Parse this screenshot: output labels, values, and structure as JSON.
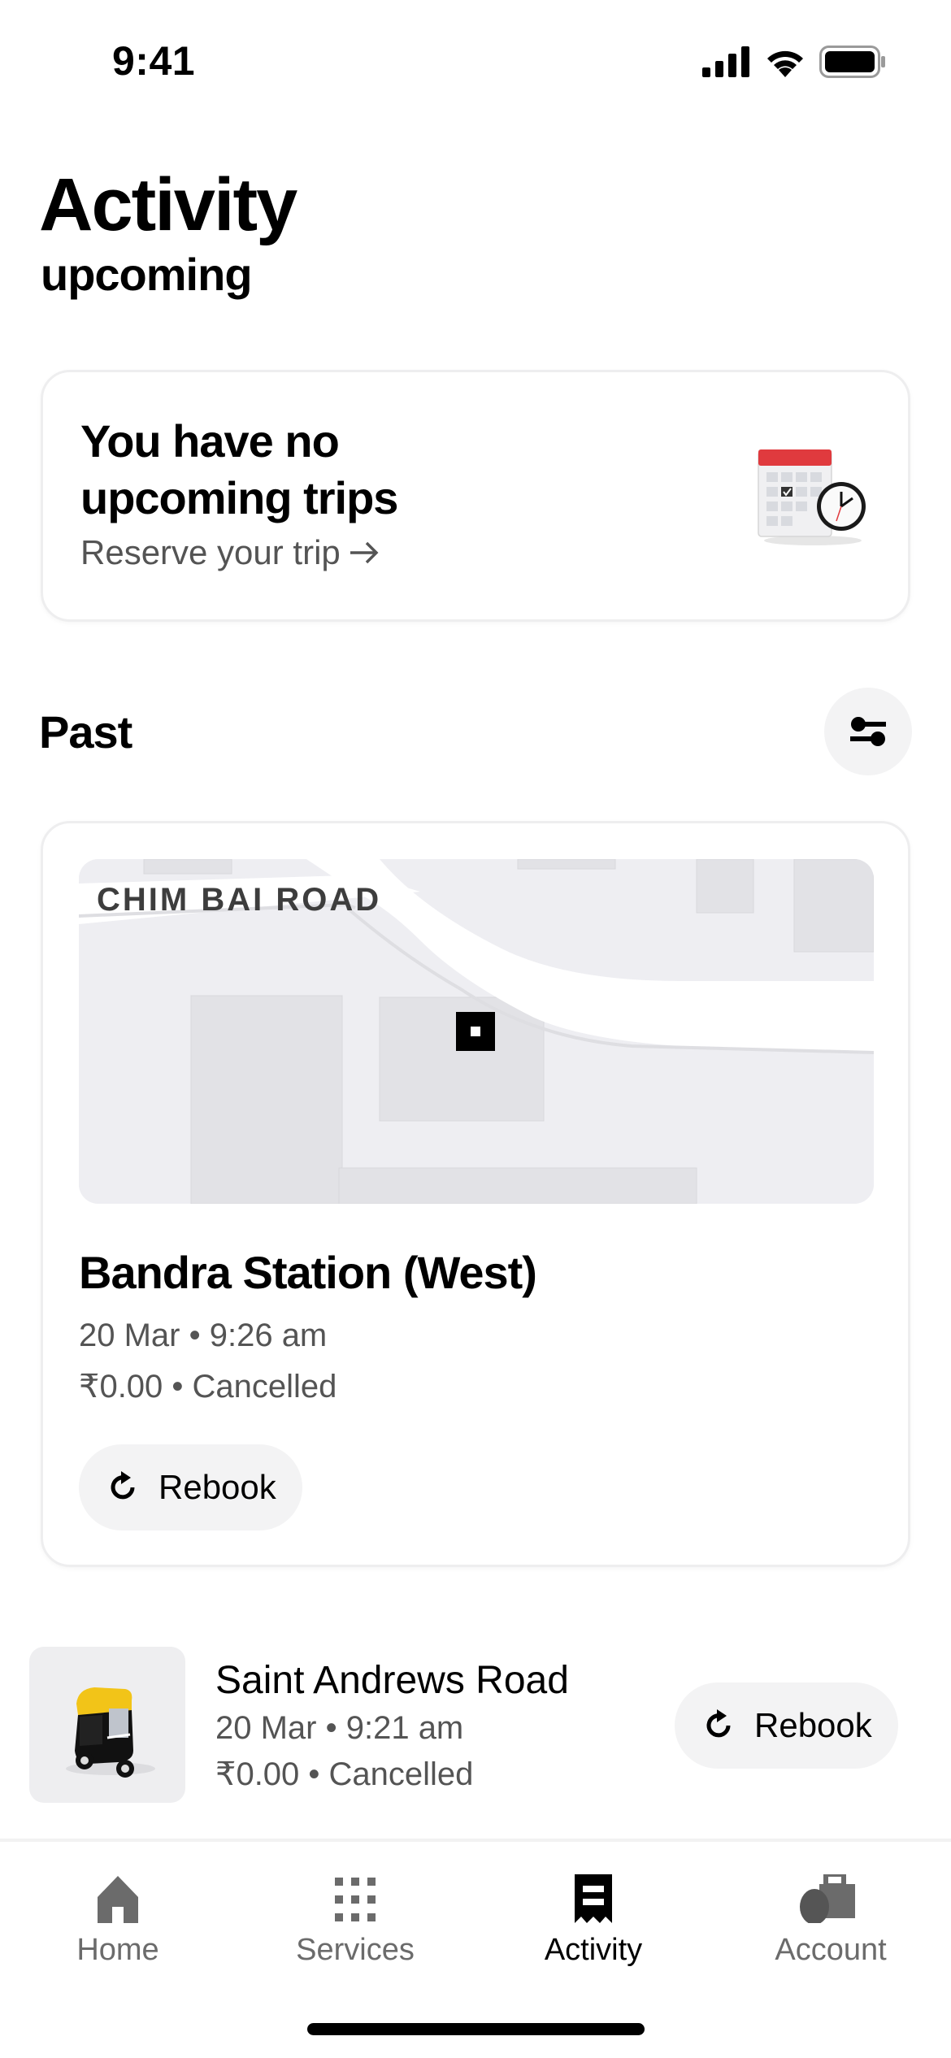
{
  "status_bar": {
    "time": "9:41",
    "icons": [
      "cellular-signal-icon",
      "wifi-icon",
      "battery-icon"
    ]
  },
  "header": {
    "title": "Activity",
    "subtitle": "upcoming"
  },
  "upcoming": {
    "title": "You have no upcoming trips",
    "link_label": "Reserve your trip",
    "link_icon": "arrow-right-icon",
    "illustration": "calendar-clock-illustration"
  },
  "past": {
    "heading": "Past",
    "filter_icon": "filter-sliders-icon",
    "featured_trip": {
      "map_road_label": "CHIM BAI ROAD",
      "destination": "Bandra Station (West)",
      "datetime": "20 Mar • 9:26 am",
      "fare_status": "₹0.00 • Cancelled",
      "rebook_label": "Rebook"
    },
    "trips": [
      {
        "vehicle": "auto-rickshaw",
        "destination": "Saint Andrews Road",
        "datetime": "20 Mar • 9:21 am",
        "fare_status": "₹0.00 • Cancelled",
        "rebook_label": "Rebook"
      }
    ]
  },
  "tabbar": {
    "active": "Activity",
    "tabs": [
      {
        "label": "Home",
        "icon": "home-icon"
      },
      {
        "label": "Services",
        "icon": "grid-icon"
      },
      {
        "label": "Activity",
        "icon": "receipt-icon"
      },
      {
        "label": "Account",
        "icon": "account-icon"
      }
    ]
  },
  "colors": {
    "text_primary": "#000000",
    "text_secondary": "#545454",
    "pill_bg": "#f3f3f4",
    "card_border": "#eeeeef",
    "tab_inactive": "#6b6b6b",
    "calendar_red": "#e03a3e",
    "auto_yellow": "#f2c418"
  }
}
